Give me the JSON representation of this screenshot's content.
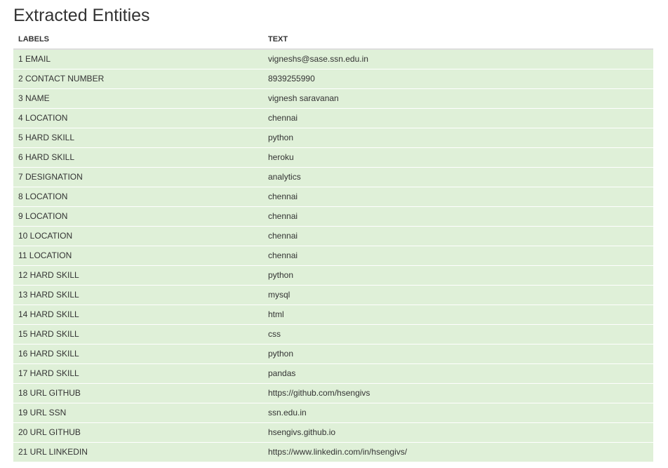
{
  "page": {
    "title": "Extracted Entities"
  },
  "table": {
    "headers": {
      "labels": "LABELS",
      "text": "TEXT"
    },
    "rows": [
      {
        "label": "1 EMAIL",
        "text": "vigneshs@sase.ssn.edu.in"
      },
      {
        "label": "2 CONTACT NUMBER",
        "text": "8939255990"
      },
      {
        "label": "3 NAME",
        "text": "vignesh saravanan"
      },
      {
        "label": "4 LOCATION",
        "text": "chennai"
      },
      {
        "label": "5 HARD SKILL",
        "text": "python"
      },
      {
        "label": "6 HARD SKILL",
        "text": "heroku"
      },
      {
        "label": "7 DESIGNATION",
        "text": "analytics"
      },
      {
        "label": "8 LOCATION",
        "text": "chennai"
      },
      {
        "label": "9 LOCATION",
        "text": "chennai"
      },
      {
        "label": "10 LOCATION",
        "text": "chennai"
      },
      {
        "label": "11 LOCATION",
        "text": "chennai"
      },
      {
        "label": "12 HARD SKILL",
        "text": "python"
      },
      {
        "label": "13 HARD SKILL",
        "text": "mysql"
      },
      {
        "label": "14 HARD SKILL",
        "text": "html"
      },
      {
        "label": "15 HARD SKILL",
        "text": "css"
      },
      {
        "label": "16 HARD SKILL",
        "text": "python"
      },
      {
        "label": "17 HARD SKILL",
        "text": "pandas"
      },
      {
        "label": "18 URL GITHUB",
        "text": "https://github.com/hsengivs"
      },
      {
        "label": "19 URL SSN",
        "text": "ssn.edu.in"
      },
      {
        "label": "20 URL GITHUB",
        "text": "hsengivs.github.io"
      },
      {
        "label": "21 URL LINKEDIN",
        "text": "https://www.linkedin.com/in/hsengivs/"
      }
    ]
  },
  "colors": {
    "row_background": "#dff0d8",
    "text": "#333333",
    "header_border": "#dddddd"
  }
}
